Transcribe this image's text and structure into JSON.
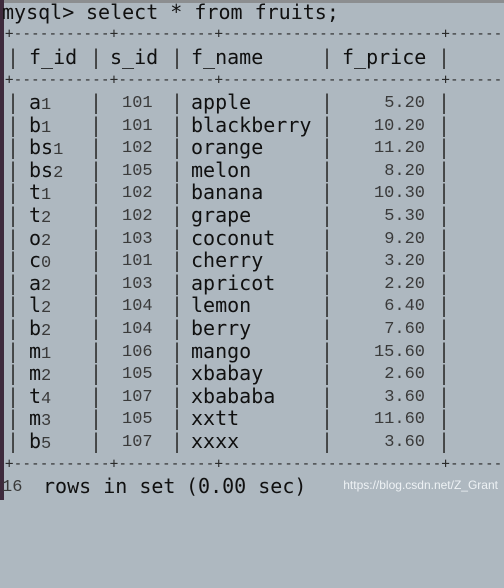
{
  "terminal": {
    "prompt": "mysql>",
    "command": "select * from fruits;",
    "columns": [
      "f_id",
      "s_id",
      "f_name",
      "f_price"
    ],
    "rows": [
      {
        "f_id_prefix": "a",
        "f_id_suffix": "1",
        "s_id": "101",
        "f_name": "apple",
        "f_price": "5.20"
      },
      {
        "f_id_prefix": "b",
        "f_id_suffix": "1",
        "s_id": "101",
        "f_name": "blackberry",
        "f_price": "10.20"
      },
      {
        "f_id_prefix": "bs",
        "f_id_suffix": "1",
        "s_id": "102",
        "f_name": "orange",
        "f_price": "11.20"
      },
      {
        "f_id_prefix": "bs",
        "f_id_suffix": "2",
        "s_id": "105",
        "f_name": "melon",
        "f_price": "8.20"
      },
      {
        "f_id_prefix": "t",
        "f_id_suffix": "1",
        "s_id": "102",
        "f_name": "banana",
        "f_price": "10.30"
      },
      {
        "f_id_prefix": "t",
        "f_id_suffix": "2",
        "s_id": "102",
        "f_name": "grape",
        "f_price": "5.30"
      },
      {
        "f_id_prefix": "o",
        "f_id_suffix": "2",
        "s_id": "103",
        "f_name": "coconut",
        "f_price": "9.20"
      },
      {
        "f_id_prefix": "c",
        "f_id_suffix": "0",
        "s_id": "101",
        "f_name": "cherry",
        "f_price": "3.20"
      },
      {
        "f_id_prefix": "a",
        "f_id_suffix": "2",
        "s_id": "103",
        "f_name": "apricot",
        "f_price": "2.20"
      },
      {
        "f_id_prefix": "l",
        "f_id_suffix": "2",
        "s_id": "104",
        "f_name": "lemon",
        "f_price": "6.40"
      },
      {
        "f_id_prefix": "b",
        "f_id_suffix": "2",
        "s_id": "104",
        "f_name": "berry",
        "f_price": "7.60"
      },
      {
        "f_id_prefix": "m",
        "f_id_suffix": "1",
        "s_id": "106",
        "f_name": "mango",
        "f_price": "15.60"
      },
      {
        "f_id_prefix": "m",
        "f_id_suffix": "2",
        "s_id": "105",
        "f_name": "xbabay",
        "f_price": "2.60"
      },
      {
        "f_id_prefix": "t",
        "f_id_suffix": "4",
        "s_id": "107",
        "f_name": "xbababa",
        "f_price": "3.60"
      },
      {
        "f_id_prefix": "m",
        "f_id_suffix": "3",
        "s_id": "105",
        "f_name": "xxtt",
        "f_price": "11.60"
      },
      {
        "f_id_prefix": "b",
        "f_id_suffix": "5",
        "s_id": "107",
        "f_name": "xxxx",
        "f_price": "3.60"
      }
    ],
    "summary": {
      "count": "16",
      "text": "rows in set",
      "timing": "(0.00 sec)"
    }
  },
  "watermark": "https://blog.csdn.net/Z_Grant",
  "colors": {
    "background": "#aeb8c0",
    "text": "#101010"
  }
}
